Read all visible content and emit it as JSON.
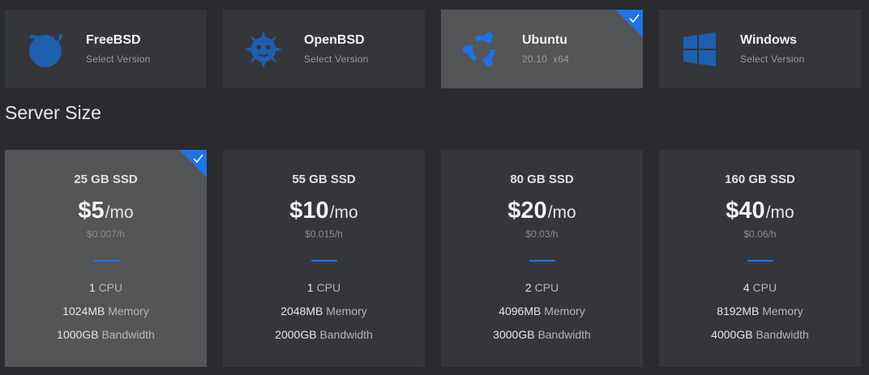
{
  "os_options": [
    {
      "name": "FreeBSD",
      "sub": "Select Version",
      "icon": "freebsd-icon",
      "selected": false
    },
    {
      "name": "OpenBSD",
      "sub": "Select Version",
      "icon": "openbsd-icon",
      "selected": false
    },
    {
      "name": "Ubuntu",
      "sub": "20.10  x64",
      "icon": "ubuntu-icon",
      "selected": true
    },
    {
      "name": "Windows",
      "sub": "Select Version",
      "icon": "windows-icon",
      "selected": false
    }
  ],
  "server_size": {
    "title": "Server Size",
    "plans": [
      {
        "disk": "25 GB SSD",
        "price": "$5",
        "unit": "/mo",
        "hourly": "$0.007/h",
        "cpu_val": "1",
        "cpu_lbl": "CPU",
        "mem_val": "1024MB",
        "mem_lbl": "Memory",
        "bw_val": "1000GB",
        "bw_lbl": "Bandwidth",
        "selected": true
      },
      {
        "disk": "55 GB SSD",
        "price": "$10",
        "unit": "/mo",
        "hourly": "$0.015/h",
        "cpu_val": "1",
        "cpu_lbl": "CPU",
        "mem_val": "2048MB",
        "mem_lbl": "Memory",
        "bw_val": "2000GB",
        "bw_lbl": "Bandwidth",
        "selected": false
      },
      {
        "disk": "80 GB SSD",
        "price": "$20",
        "unit": "/mo",
        "hourly": "$0.03/h",
        "cpu_val": "2",
        "cpu_lbl": "CPU",
        "mem_val": "4096MB",
        "mem_lbl": "Memory",
        "bw_val": "3000GB",
        "bw_lbl": "Bandwidth",
        "selected": false
      },
      {
        "disk": "160 GB SSD",
        "price": "$40",
        "unit": "/mo",
        "hourly": "$0.06/h",
        "cpu_val": "4",
        "cpu_lbl": "CPU",
        "mem_val": "8192MB",
        "mem_lbl": "Memory",
        "bw_val": "4000GB",
        "bw_lbl": "Bandwidth",
        "selected": false
      }
    ]
  },
  "colors": {
    "accent": "#1e73e8",
    "card_bg": "#34363a",
    "card_selected_bg": "#545556",
    "page_bg": "#2a2b2f"
  }
}
